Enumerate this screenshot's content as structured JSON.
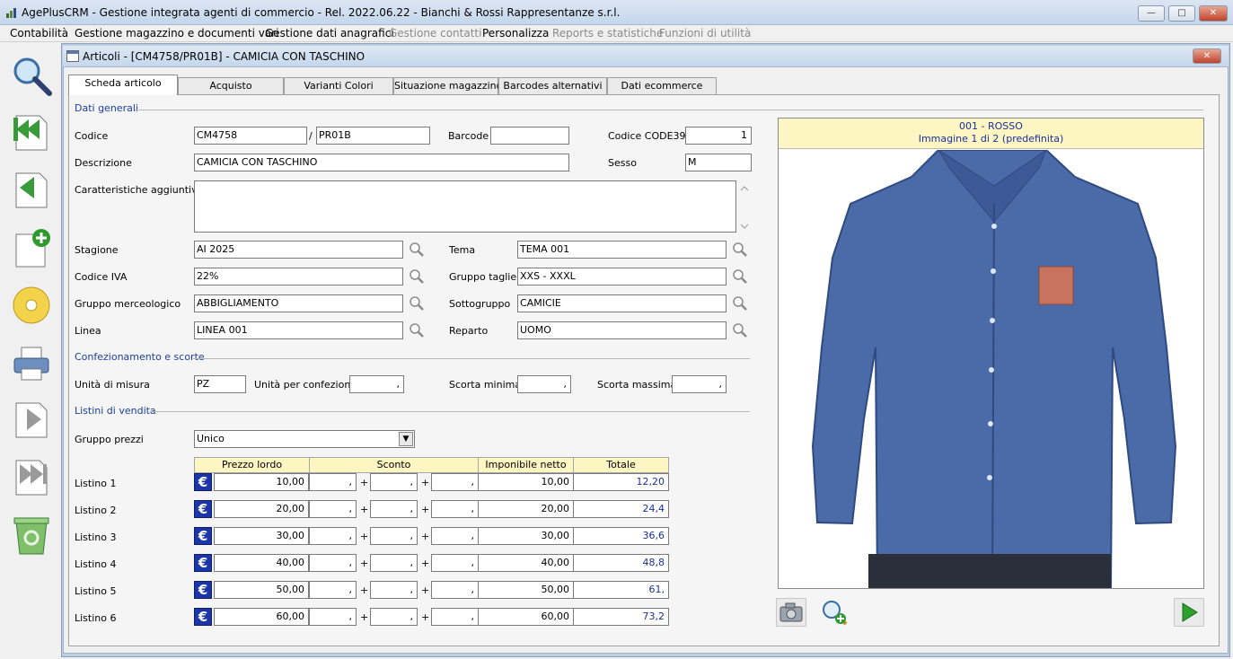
{
  "app": {
    "title": "AgePlusCRM - Gestione integrata agenti di commercio - Rel. 2022.06.22 - Bianchi & Rossi Rappresentanze s.r.l.",
    "icon": "app-icon",
    "minimize": "—",
    "maximize": "□",
    "close": "✕"
  },
  "menu": [
    {
      "label": "Contabilità",
      "enabled": true
    },
    {
      "label": "Gestione magazzino e documenti vari",
      "enabled": true
    },
    {
      "label": "Gestione dati anagrafici",
      "enabled": true
    },
    {
      "label": "Gestione contatti",
      "enabled": false
    },
    {
      "label": "Personalizza",
      "enabled": true
    },
    {
      "label": "Reports e statistiche",
      "enabled": false
    },
    {
      "label": "Funzioni di utilità",
      "enabled": false
    }
  ],
  "toolbar": [
    "search-icon",
    "first-record-icon",
    "previous-record-icon",
    "new-record-icon",
    "save-disk-icon",
    "print-icon",
    "next-record-icon",
    "last-record-icon",
    "recycle-bin-icon"
  ],
  "window": {
    "title": "Articoli - [CM4758/PR01B] - CAMICIA CON TASCHINO",
    "close": "✕"
  },
  "tabs": [
    "Scheda articolo",
    "Acquisto",
    "Varianti Colori",
    "Situazione magazzino",
    "Barcodes alternativi",
    "Dati ecommerce"
  ],
  "sections": {
    "general": "Dati generali",
    "packaging": "Confezionamento e scorte",
    "prices": "Listini di vendita"
  },
  "labels": {
    "codice": "Codice",
    "slash": "/",
    "barcode": "Barcode",
    "code39": "Codice CODE39",
    "descrizione": "Descrizione",
    "sesso": "Sesso",
    "caratteristiche": "Caratteristiche aggiuntive",
    "stagione": "Stagione",
    "tema": "Tema",
    "iva": "Codice IVA",
    "taglie": "Gruppo taglie",
    "merceologico": "Gruppo merceologico",
    "sottogruppo": "Sottogruppo",
    "linea": "Linea",
    "reparto": "Reparto",
    "um": "Unità di misura",
    "upc": "Unità per confezione",
    "scortamin": "Scorta minima",
    "scortamax": "Scorta massima",
    "gruppoprezzi": "Gruppo prezzi"
  },
  "values": {
    "codice1": "CM4758",
    "codice2": "PR01B",
    "barcode": "",
    "code39": "1",
    "descrizione": "CAMICIA CON TASCHINO",
    "sesso": "M",
    "caratteristiche": "",
    "stagione": "AI 2025",
    "tema": "TEMA 001",
    "iva": "22%",
    "taglie": "XXS - XXXL",
    "merceologico": "ABBIGLIAMENTO",
    "sottogruppo": "CAMICIE",
    "linea": "LINEA 001",
    "reparto": "UOMO",
    "um": "PZ",
    "upc": ",",
    "scortamin": ",",
    "scortamax": ",",
    "gruppoprezzi": "Unico"
  },
  "grid": {
    "headers": [
      "Prezzo lordo",
      "Sconto",
      "Imponibile netto",
      "Totale"
    ],
    "currency": "€",
    "plus": "+",
    "rows": [
      {
        "label": "Listino 1",
        "lordo": "10,00",
        "s1": ",",
        "s2": ",",
        "s3": ",",
        "netto": "10,00",
        "totale": "12,20"
      },
      {
        "label": "Listino 2",
        "lordo": "20,00",
        "s1": ",",
        "s2": ",",
        "s3": ",",
        "netto": "20,00",
        "totale": "24,4"
      },
      {
        "label": "Listino 3",
        "lordo": "30,00",
        "s1": ",",
        "s2": ",",
        "s3": ",",
        "netto": "30,00",
        "totale": "36,6"
      },
      {
        "label": "Listino 4",
        "lordo": "40,00",
        "s1": ",",
        "s2": ",",
        "s3": ",",
        "netto": "40,00",
        "totale": "48,8"
      },
      {
        "label": "Listino 5",
        "lordo": "50,00",
        "s1": ",",
        "s2": ",",
        "s3": ",",
        "netto": "50,00",
        "totale": "61,"
      },
      {
        "label": "Listino 6",
        "lordo": "60,00",
        "s1": ",",
        "s2": ",",
        "s3": ",",
        "netto": "60,00",
        "totale": "73,2"
      }
    ]
  },
  "image": {
    "line1": "001 - ROSSO",
    "line2": "Immagine 1 di 2 (predefinita)"
  },
  "colors": {
    "accent": "#1a3f9c",
    "header_bg": "#fdf6c3",
    "shirt": "#4a6aa8",
    "pocket": "#c8735e"
  }
}
